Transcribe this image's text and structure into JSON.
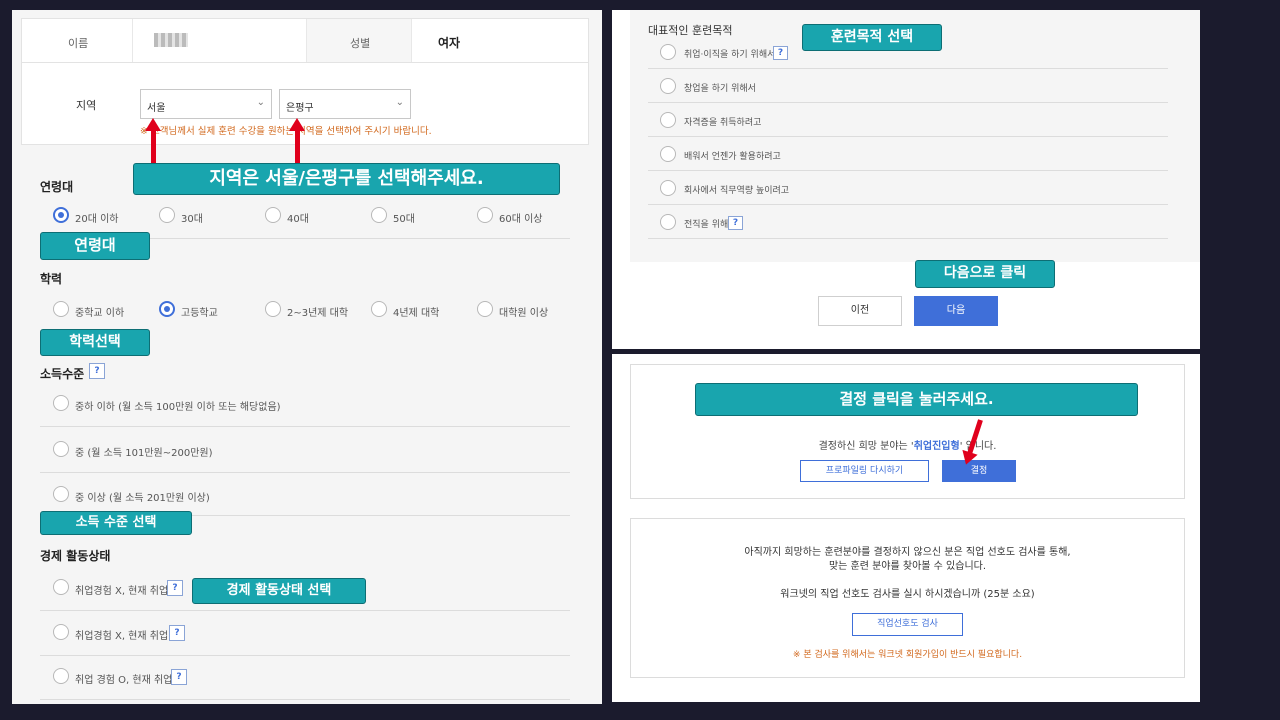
{
  "left": {
    "name_label": "이름",
    "gender_label": "성별",
    "gender_value": "여자",
    "region_label": "지역",
    "region_select": "서울",
    "district_select": "은평구",
    "region_note": "※ 고객님께서 실제 훈련 수강을 원하는 지역을 선택하여 주시기 바랍니다.",
    "region_tag": "지역은 서울/은평구를 선택해주세요.",
    "age_title": "연령대",
    "age_options": [
      "20대 이하",
      "30대",
      "40대",
      "50대",
      "60대 이상"
    ],
    "age_tag": "연령대",
    "edu_title": "학력",
    "edu_options": [
      "중학교 이하",
      "고등학교",
      "2~3년제 대학",
      "4년제 대학",
      "대학원 이상"
    ],
    "edu_tag": "학력선택",
    "income_title": "소득수준",
    "income_options": [
      "중하 이하 (월 소득 100만원 이하 또는 해당없음)",
      "중 (월 소득 101만원~200만원)",
      "중 이상 (월 소득 201만원 이상)"
    ],
    "income_tag": "소득 수준 선택",
    "econ_title": "경제 활동상태",
    "econ_options": [
      "취업경험 X, 현재 취업 X",
      "취업경험 X, 현재 취업 O",
      "취업 경험 O, 현재 취업 X"
    ],
    "econ_tag": "경제 활동상태 선택",
    "help_glyph": "?"
  },
  "rtop": {
    "title": "대표적인 훈련목적",
    "purpose_tag": "훈련목적 선택",
    "purposes": [
      "취업·이직을 하기 위해서",
      "창업을 하기 위해서",
      "자격증을 취득하려고",
      "배워서 언젠가 활용하려고",
      "회사에서 직무역량 높이려고",
      "전직을 위해"
    ],
    "next_tag": "다음으로 클릭",
    "prev_button": "이전",
    "next_button": "다음"
  },
  "rbot": {
    "decide_tag": "결정 클릭을 눌러주세요.",
    "result_prefix": "결정하신 희망 분야는 '",
    "result_value": "취업진입형",
    "result_suffix": "' 입니다.",
    "reprofile_button": "프로파일링 다시하기",
    "decide_button": "결정",
    "info_line1": "아직까지 희망하는 훈련분야를 결정하지 않으신 분은 직업 선호도 검사를 통해,",
    "info_line2": "맞는 훈련 분야를 찾아볼 수 있습니다.",
    "info_line3": "워크넷의 직업 선호도 검사를 실시 하시겠습니까 (25분 소요)",
    "test_button": "직업선호도 검사",
    "warning": "※ 본 검사를 위해서는 워크넷 회원가입이 반드시 필요합니다."
  },
  "colors": {
    "accent": "#3f6fd9",
    "tag": "#19a5ae",
    "arrow": "#e0001c",
    "note": "#d2691e"
  }
}
